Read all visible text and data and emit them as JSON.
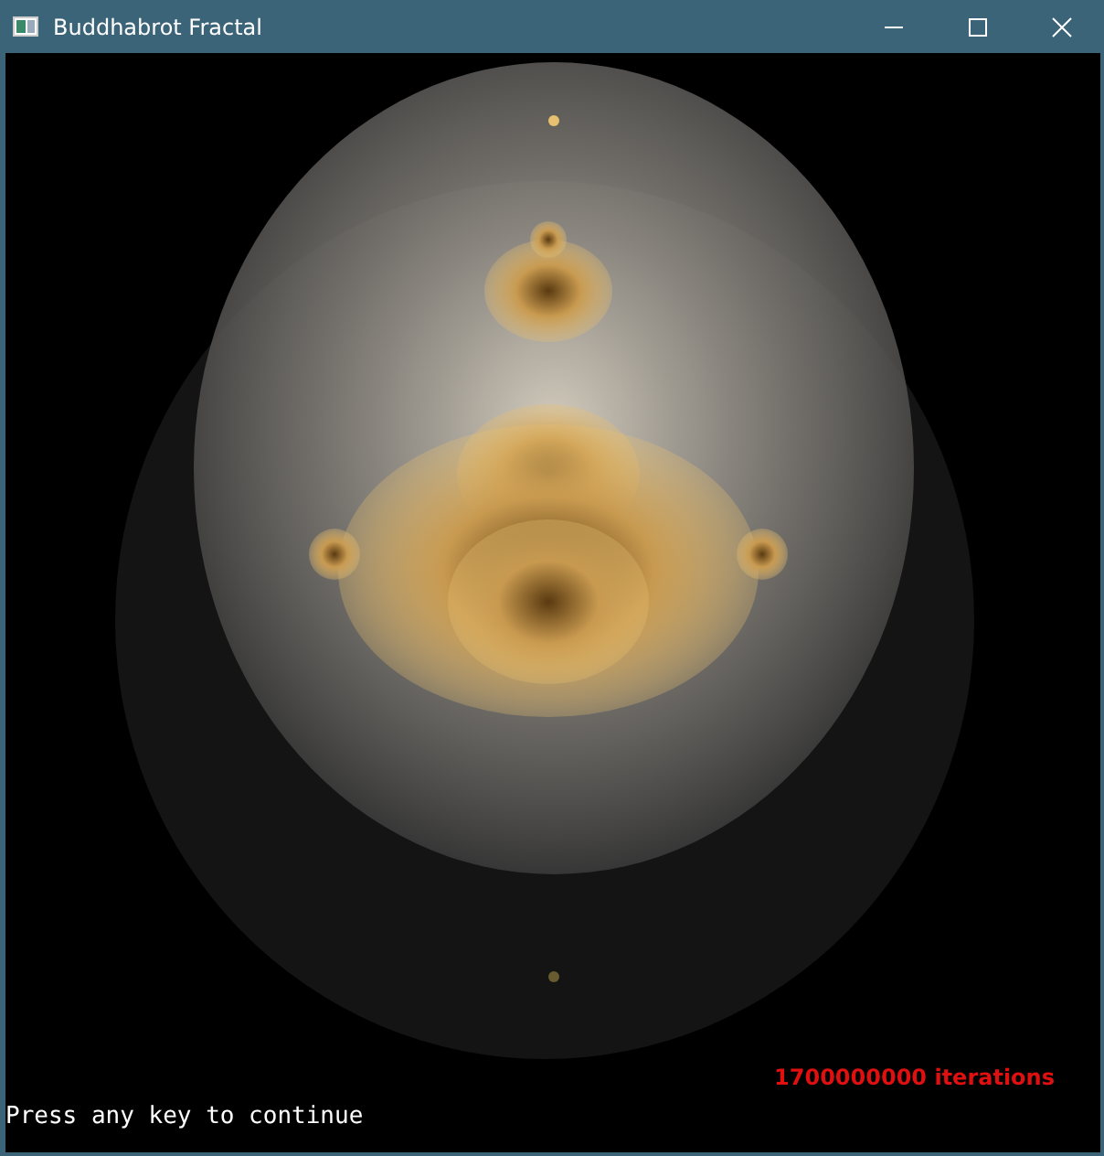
{
  "window": {
    "title": "Buddhabrot Fractal"
  },
  "render": {
    "iterations_label": "1700000000 iterations",
    "prompt": "Press any key to continue"
  }
}
